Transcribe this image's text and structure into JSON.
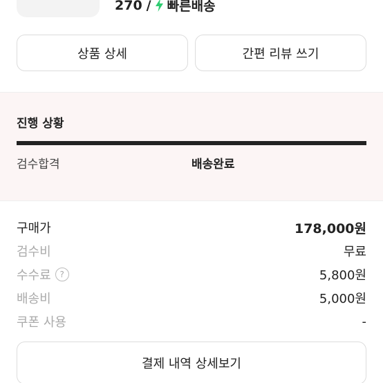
{
  "product": {
    "size": "270",
    "separator": "/",
    "shipping_label": "빠른배송",
    "bolt_color": "#2ecc71"
  },
  "actions": {
    "product_detail": "상품 상세",
    "simple_review": "간편 리뷰 쓰기"
  },
  "progress": {
    "title": "진행 상황",
    "steps": [
      "검수합격",
      "배송완료"
    ],
    "current_step": 2,
    "fill_fraction": 1.0
  },
  "fees": {
    "purchase_price": {
      "label": "구매가",
      "value": "178,000원"
    },
    "inspection": {
      "label": "검수비",
      "value": "무료"
    },
    "commission": {
      "label": "수수료",
      "value": "5,800원",
      "help_icon": "?"
    },
    "shipping": {
      "label": "배송비",
      "value": "5,000원"
    },
    "coupon": {
      "label": "쿠폰 사용",
      "value": "-"
    }
  },
  "payment_detail_button": "결제 내역 상세보기"
}
